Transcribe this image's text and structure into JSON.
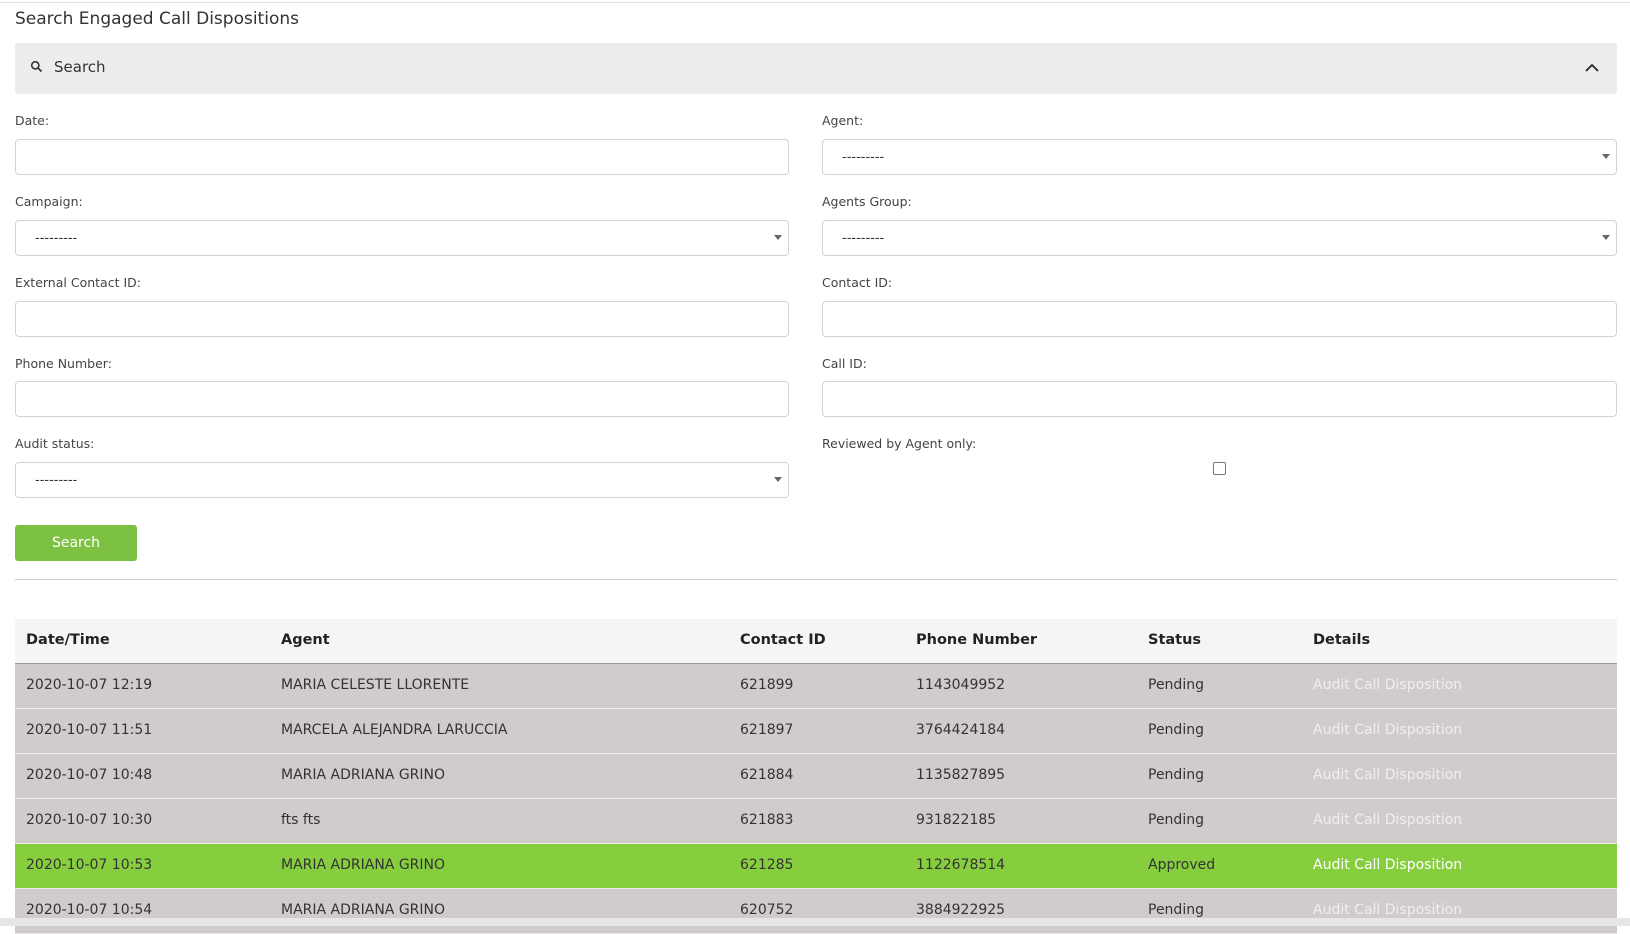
{
  "page": {
    "title": "Search Engaged Call Dispositions"
  },
  "search_panel": {
    "label": "Search",
    "search_icon": "search-icon",
    "collapse_icon": "chevron-up-icon"
  },
  "form": {
    "date_label": "Date:",
    "date_value": "",
    "agent_label": "Agent:",
    "agent_value": "---------",
    "campaign_label": "Campaign:",
    "campaign_value": "---------",
    "agents_group_label": "Agents Group:",
    "agents_group_value": "---------",
    "external_contact_id_label": "External Contact ID:",
    "external_contact_id_value": "",
    "contact_id_label": "Contact ID:",
    "contact_id_value": "",
    "phone_number_label": "Phone Number:",
    "phone_number_value": "",
    "call_id_label": "Call ID:",
    "call_id_value": "",
    "audit_status_label": "Audit status:",
    "audit_status_value": "---------",
    "reviewed_label": "Reviewed by Agent only:",
    "reviewed_checked": false,
    "search_button": "Search"
  },
  "table": {
    "headers": [
      "Date/Time",
      "Agent",
      "Contact ID",
      "Phone Number",
      "Status",
      "Details"
    ],
    "rows": [
      {
        "datetime": "2020-10-07 12:19",
        "agent": "MARIA CELESTE LLORENTE",
        "contact_id": "621899",
        "phone": "1143049952",
        "status": "Pending",
        "details": "Audit Call Disposition"
      },
      {
        "datetime": "2020-10-07 11:51",
        "agent": "MARCELA ALEJANDRA LARUCCIA",
        "contact_id": "621897",
        "phone": "3764424184",
        "status": "Pending",
        "details": "Audit Call Disposition"
      },
      {
        "datetime": "2020-10-07 10:48",
        "agent": "MARIA ADRIANA GRINO",
        "contact_id": "621884",
        "phone": "1135827895",
        "status": "Pending",
        "details": "Audit Call Disposition"
      },
      {
        "datetime": "2020-10-07 10:30",
        "agent": "fts fts",
        "contact_id": "621883",
        "phone": "931822185",
        "status": "Pending",
        "details": "Audit Call Disposition"
      },
      {
        "datetime": "2020-10-07 10:53",
        "agent": "MARIA ADRIANA GRINO",
        "contact_id": "621285",
        "phone": "1122678514",
        "status": "Approved",
        "details": "Audit Call Disposition"
      },
      {
        "datetime": "2020-10-07 10:54",
        "agent": "MARIA ADRIANA GRINO",
        "contact_id": "620752",
        "phone": "3884922925",
        "status": "Pending",
        "details": "Audit Call Disposition"
      }
    ]
  },
  "colors": {
    "accent": "#7dc142",
    "approved_row": "#86ce3e",
    "pending_row": "#d1cccb"
  }
}
